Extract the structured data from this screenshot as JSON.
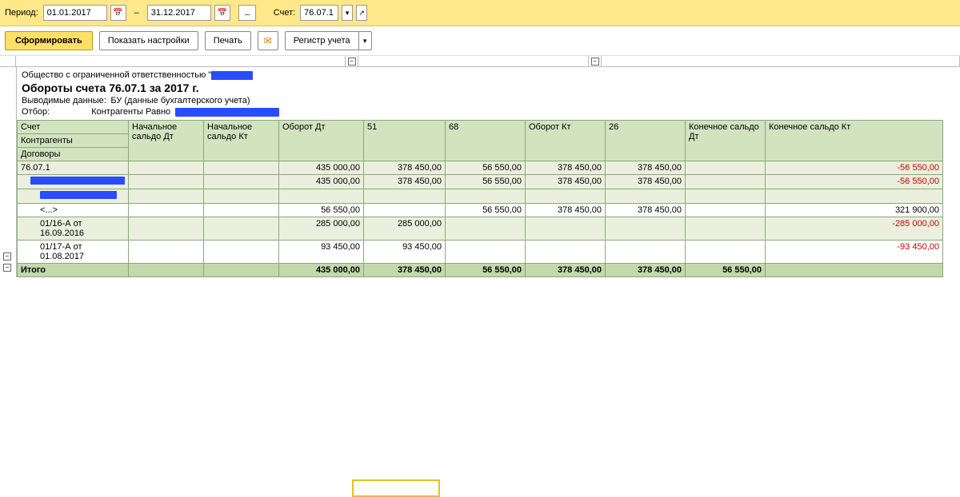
{
  "topbar": {
    "period_label": "Период:",
    "date_from": "01.01.2017",
    "date_to": "31.12.2017",
    "dash": "–",
    "ellipsis": "...",
    "acct_label": "Счет:",
    "acct_value": "76.07.1"
  },
  "toolbar": {
    "generate": "Сформировать",
    "show_settings": "Показать настройки",
    "print": "Печать",
    "register": "Регистр учета"
  },
  "header": {
    "org_prefix": "Общество с ограниченной ответственностью \"",
    "title": "Обороты счета 76.07.1 за 2017 г.",
    "data_label": "Выводимые данные:",
    "data_value": "БУ (данные бухгалтерского учета)",
    "filter_label": "Отбор:",
    "filter_value": "Контрагенты Равно"
  },
  "columns": {
    "acct": "Счет",
    "counterparty": "Контрагенты",
    "contracts": "Договоры",
    "start_dt": "Начальное сальдо Дт",
    "start_kt": "Начальное сальдо Кт",
    "turn_dt": "Оборот Дт",
    "c51": "51",
    "c68": "68",
    "turn_kt": "Оборот Кт",
    "c26": "26",
    "end_dt": "Конечное сальдо Дт",
    "end_kt": "Конечное сальдо Кт"
  },
  "rows": [
    {
      "label": "76.07.1",
      "v": [
        "",
        "",
        "435 000,00",
        "378 450,00",
        "56 550,00",
        "378 450,00",
        "378 450,00",
        "",
        "-56 550,00"
      ],
      "neg": [
        8
      ],
      "cls": "even",
      "indent": 0
    },
    {
      "label": "REDACT1",
      "v": [
        "",
        "",
        "435 000,00",
        "378 450,00",
        "56 550,00",
        "378 450,00",
        "378 450,00",
        "",
        "-56 550,00"
      ],
      "neg": [
        8
      ],
      "cls": "even",
      "indent": 1
    },
    {
      "label": "REDACT2",
      "v": [
        "",
        "",
        "",
        "",
        "",
        "",
        "",
        "",
        ""
      ],
      "neg": [],
      "cls": "even",
      "indent": 2
    },
    {
      "label": "<...>",
      "v": [
        "",
        "",
        "56 550,00",
        "",
        "56 550,00",
        "378 450,00",
        "378 450,00",
        "",
        "321 900,00"
      ],
      "neg": [],
      "cls": "odd",
      "indent": 2
    },
    {
      "label": "01/16-А от 16.09.2016",
      "v": [
        "",
        "",
        "285 000,00",
        "285 000,00",
        "",
        "",
        "",
        "",
        "-285 000,00"
      ],
      "neg": [
        8
      ],
      "cls": "even",
      "indent": 2
    },
    {
      "label": "01/17-А от 01.08.2017",
      "v": [
        "",
        "",
        "93 450,00",
        "93 450,00",
        "",
        "",
        "",
        "",
        "-93 450,00"
      ],
      "neg": [
        8
      ],
      "cls": "odd",
      "indent": 2
    }
  ],
  "total": {
    "label": "Итого",
    "v": [
      "",
      "",
      "435 000,00",
      "378 450,00",
      "56 550,00",
      "378 450,00",
      "378 450,00",
      "56 550,00",
      ""
    ]
  }
}
